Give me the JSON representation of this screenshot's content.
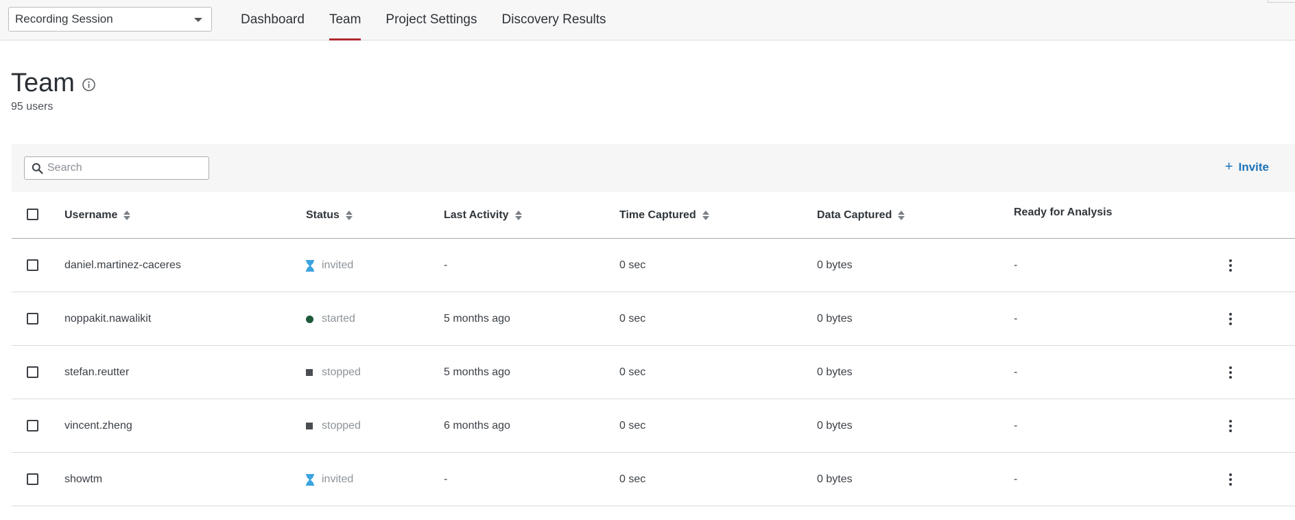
{
  "topbar": {
    "session_select": {
      "value": "Recording Session"
    },
    "tabs": [
      {
        "label": "Dashboard",
        "active": false
      },
      {
        "label": "Team",
        "active": true
      },
      {
        "label": "Project Settings",
        "active": false
      },
      {
        "label": "Discovery Results",
        "active": false
      }
    ],
    "accent_color": "#b02a30"
  },
  "page": {
    "title": "Team",
    "info_icon": "info-circle-icon",
    "user_count": "95 users"
  },
  "toolbar": {
    "search": {
      "placeholder": "Search",
      "value": ""
    },
    "invite_label": "Invite",
    "invite_color": "#1d73b8"
  },
  "table": {
    "columns": [
      {
        "label": "Username",
        "sortable": true
      },
      {
        "label": "Status",
        "sortable": true
      },
      {
        "label": "Last Activity",
        "sortable": true
      },
      {
        "label": "Time Captured",
        "sortable": true
      },
      {
        "label": "Data Captured",
        "sortable": true
      },
      {
        "label": "Ready for Analysis",
        "sortable": false
      }
    ],
    "rows": [
      {
        "username": "daniel.martinez-caceres",
        "status": "invited",
        "status_icon": "hourglass-icon",
        "last_activity": "-",
        "time_captured": "0 sec",
        "data_captured": "0 bytes",
        "ready": "-"
      },
      {
        "username": "noppakit.nawalikit",
        "status": "started",
        "status_icon": "green-dot-icon",
        "last_activity": "5 months ago",
        "time_captured": "0 sec",
        "data_captured": "0 bytes",
        "ready": "-"
      },
      {
        "username": "stefan.reutter",
        "status": "stopped",
        "status_icon": "stop-square-icon",
        "last_activity": "5 months ago",
        "time_captured": "0 sec",
        "data_captured": "0 bytes",
        "ready": "-"
      },
      {
        "username": "vincent.zheng",
        "status": "stopped",
        "status_icon": "stop-square-icon",
        "last_activity": "6 months ago",
        "time_captured": "0 sec",
        "data_captured": "0 bytes",
        "ready": "-"
      },
      {
        "username": "showtm",
        "status": "invited",
        "status_icon": "hourglass-icon",
        "last_activity": "-",
        "time_captured": "0 sec",
        "data_captured": "0 bytes",
        "ready": "-"
      }
    ]
  }
}
